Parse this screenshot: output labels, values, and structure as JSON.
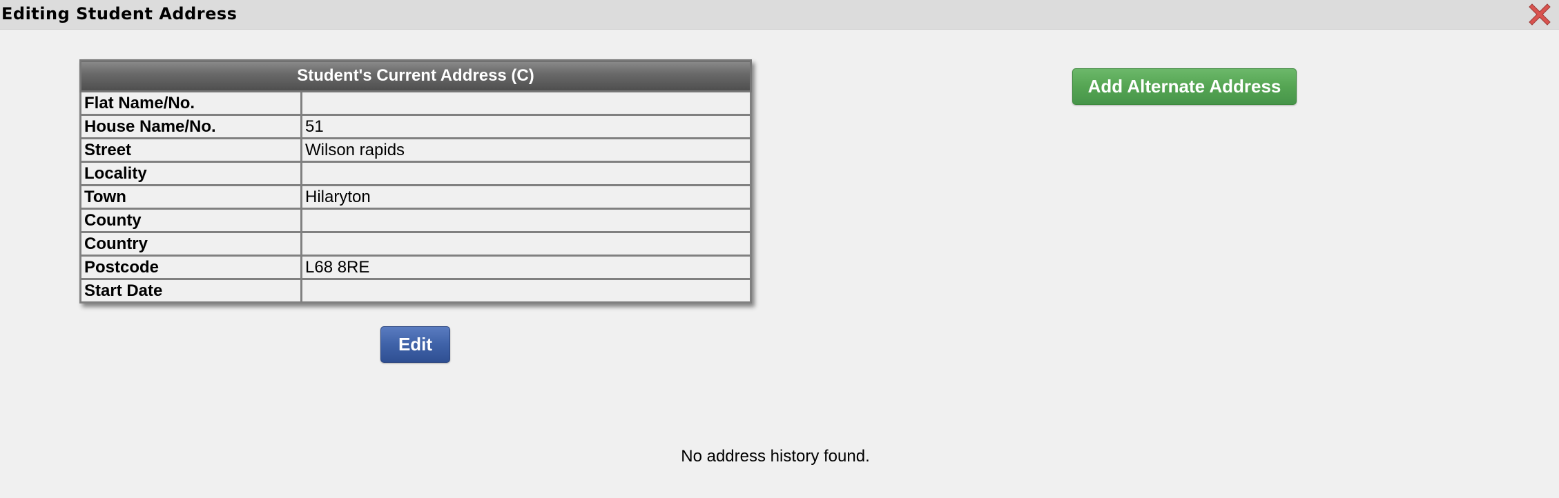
{
  "window": {
    "title": "Editing Student Address",
    "close_icon": "close-icon",
    "close_color": "#d9534f"
  },
  "current_address": {
    "header": "Student's Current Address (C)",
    "rows": [
      {
        "label": "Flat Name/No.",
        "value": ""
      },
      {
        "label": "House Name/No.",
        "value": "51"
      },
      {
        "label": "Street",
        "value": "Wilson rapids"
      },
      {
        "label": "Locality",
        "value": ""
      },
      {
        "label": "Town",
        "value": "Hilaryton"
      },
      {
        "label": "County",
        "value": ""
      },
      {
        "label": "Country",
        "value": ""
      },
      {
        "label": "Postcode",
        "value": "L68 8RE"
      },
      {
        "label": "Start Date",
        "value": ""
      }
    ],
    "edit_label": "Edit"
  },
  "actions": {
    "add_alternate_label": "Add Alternate Address"
  },
  "history": {
    "message": "No address history found."
  },
  "colors": {
    "primary_button": "#3f62a8",
    "success_button": "#55a553",
    "table_header": "#5a5a5a",
    "background": "#f0f0f0"
  }
}
